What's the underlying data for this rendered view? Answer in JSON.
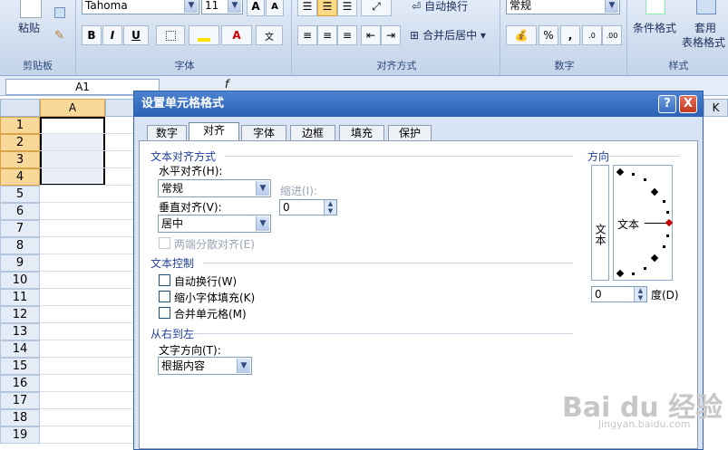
{
  "ribbon": {
    "paste_label": "粘贴",
    "clipboard_group": "剪贴板",
    "font_name": "Tahoma",
    "font_size": "11",
    "font_group": "字体",
    "align_group": "对齐方式",
    "wrap_text": "自动换行",
    "merge_center": "合并后居中",
    "number_format": "常规",
    "number_group": "数字",
    "percent": "%",
    "comma": ",",
    "cond_format": "条件格式",
    "table_format_1": "套用",
    "table_format_2": "表格格式",
    "styles_group": "样式",
    "bold": "B",
    "italic": "I",
    "underline": "U",
    "font_color_glyph": "A",
    "grow_font": "A",
    "fx": "f"
  },
  "formula_bar": {
    "name_box": "A1"
  },
  "sheet": {
    "column_a": "A",
    "column_k": "K",
    "rows": [
      "1",
      "2",
      "3",
      "4",
      "5",
      "6",
      "7",
      "8",
      "9",
      "10",
      "11",
      "12",
      "13",
      "14",
      "15",
      "16",
      "17",
      "18",
      "19"
    ],
    "selected_rows": [
      "1",
      "2",
      "3",
      "4"
    ]
  },
  "dialog": {
    "title": "设置单元格格式",
    "help": "?",
    "close": "X",
    "tabs": [
      "数字",
      "对齐",
      "字体",
      "边框",
      "填充",
      "保护"
    ],
    "active_tab": "对齐",
    "text_align_section": "文本对齐方式",
    "horizontal_label": "水平对齐(H):",
    "horizontal_value": "常规",
    "indent_label": "缩进(I):",
    "indent_value": "0",
    "vertical_label": "垂直对齐(V):",
    "vertical_value": "居中",
    "justify_distributed": "两端分散对齐(E)",
    "text_control_section": "文本控制",
    "wrap_text": "自动换行(W)",
    "shrink_to_fit": "缩小字体填充(K)",
    "merge_cells": "合并单元格(M)",
    "rtl_section": "从右到左",
    "text_direction_label": "文字方向(T):",
    "text_direction_value": "根据内容",
    "orientation_section": "方向",
    "vertical_text": "文本",
    "dial_text": "文本",
    "degree_value": "0",
    "degree_label": "度(D)"
  },
  "watermark": {
    "brand": "Bai du 经验",
    "url": "jingyan.baidu.com"
  }
}
